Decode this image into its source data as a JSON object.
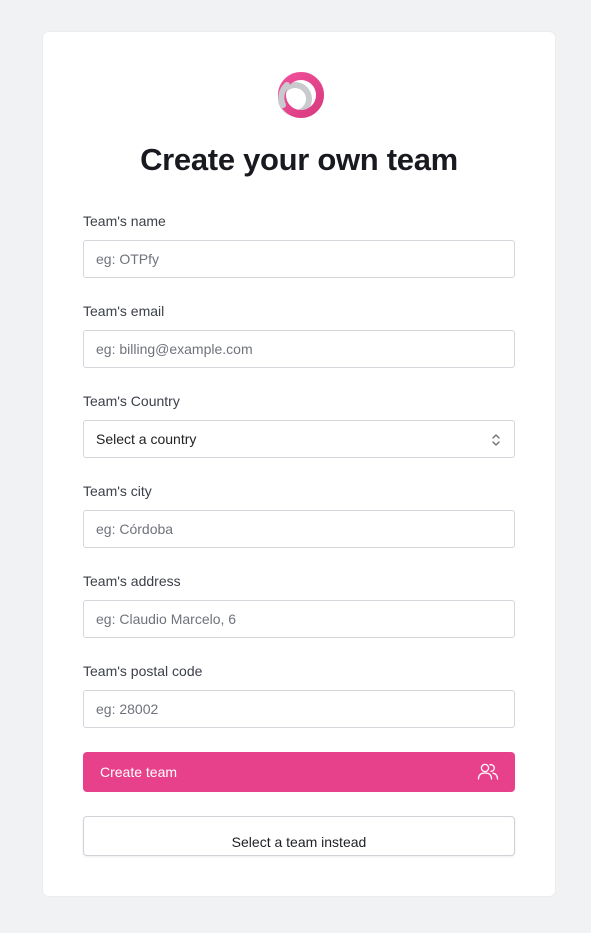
{
  "app": {
    "logo_icon": "circle-logo-icon",
    "brand_color": "#e8418c"
  },
  "form": {
    "title": "Create your own team",
    "fields": [
      {
        "label": "Team's name",
        "placeholder": "eg: OTPfy"
      },
      {
        "label": "Team's email",
        "placeholder": "eg: billing@example.com"
      },
      {
        "label": "Team's Country",
        "value": "Select a country",
        "icon": "select-arrows-icon"
      },
      {
        "label": "Team's city",
        "placeholder": "eg: Córdoba"
      },
      {
        "label": "Team's address",
        "placeholder": "eg: Claudio Marcelo, 6"
      },
      {
        "label": "Team's postal code",
        "placeholder": "eg: 28002"
      }
    ],
    "create_button": {
      "label": "Create team",
      "icon": "team-icon"
    },
    "select_team_button": {
      "label": "Select a team instead"
    }
  }
}
